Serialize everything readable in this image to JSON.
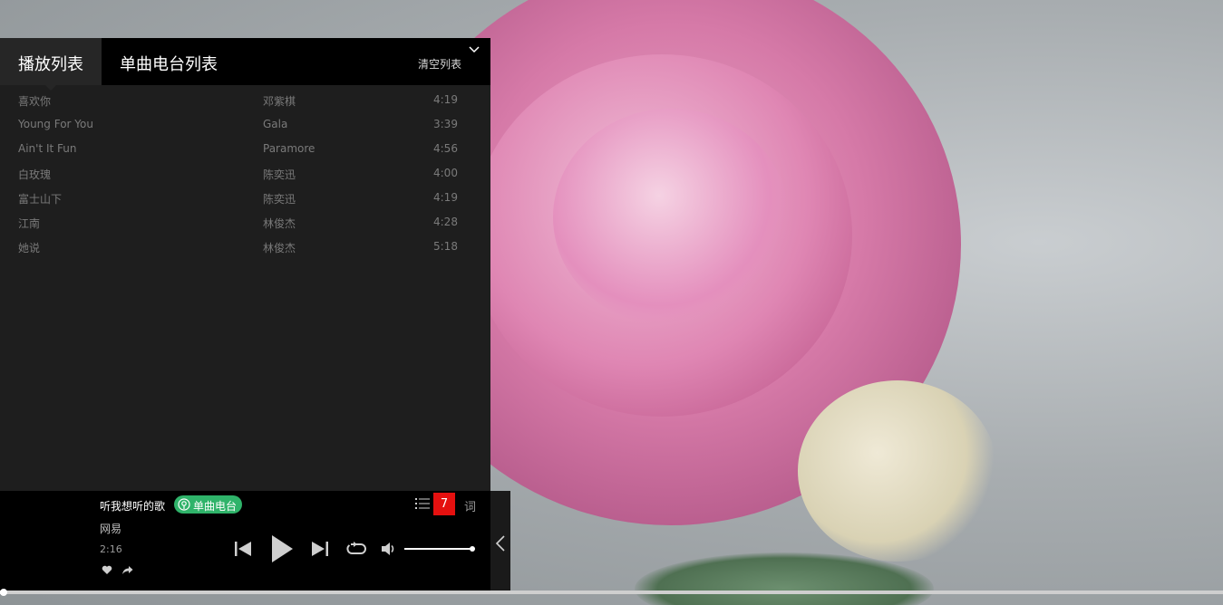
{
  "tabs": {
    "playlist": "播放列表",
    "radio": "单曲电台列表"
  },
  "clear_label": "清空列表",
  "playlist": [
    {
      "title": "喜欢你",
      "artist": "邓紫棋",
      "duration": "4:19"
    },
    {
      "title": "Young For You",
      "artist": "Gala",
      "duration": "3:39"
    },
    {
      "title": "Ain't It Fun",
      "artist": "Paramore",
      "duration": "4:56"
    },
    {
      "title": "白玫瑰",
      "artist": "陈奕迅",
      "duration": "4:00"
    },
    {
      "title": "富士山下",
      "artist": "陈奕迅",
      "duration": "4:19"
    },
    {
      "title": "江南",
      "artist": "林俊杰",
      "duration": "4:28"
    },
    {
      "title": "她说",
      "artist": "林俊杰",
      "duration": "5:18"
    }
  ],
  "player": {
    "song_title": "听我想听的歌",
    "radio_badge": "单曲电台",
    "artist": "网易",
    "time": "2:16",
    "playlist_count": "7",
    "lyrics_label": "词",
    "volume_level": 1.0,
    "progress_fraction": 0.003
  },
  "icons": {
    "collapse": "chevron-down-icon",
    "radio": "radio-icon",
    "like": "heart-icon",
    "share": "share-icon",
    "list": "list-icon",
    "prev": "previous-icon",
    "play": "play-icon",
    "next": "next-icon",
    "loop": "loop-icon",
    "volume": "volume-icon",
    "side_tab": "chevron-left-icon"
  },
  "colors": {
    "accent_green": "#2fb36a",
    "badge_red": "#e5100f"
  }
}
